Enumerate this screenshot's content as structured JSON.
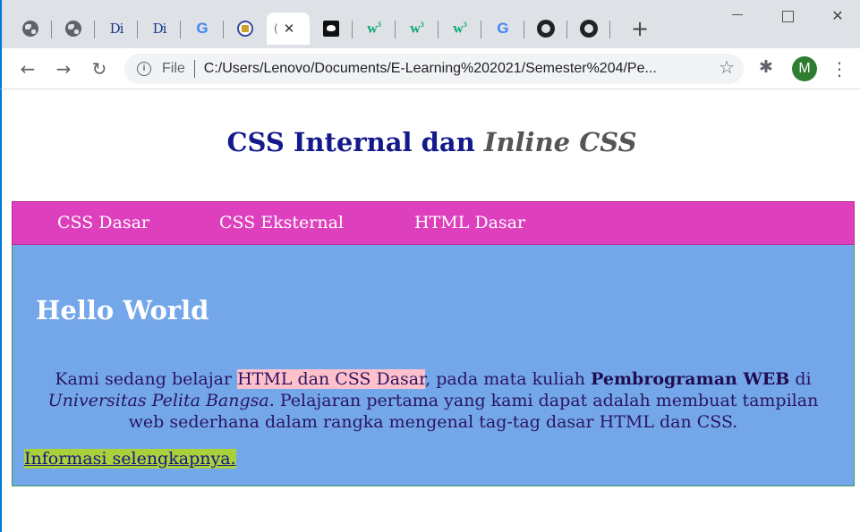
{
  "browser": {
    "tabs": [
      {
        "icon": "globe-icon"
      },
      {
        "icon": "globe-icon"
      },
      {
        "icon": "di-favicon",
        "text": "Di"
      },
      {
        "icon": "di-favicon",
        "text": "Di"
      },
      {
        "icon": "google-icon",
        "text": "G"
      },
      {
        "icon": "university-icon"
      },
      {
        "icon": "page-icon",
        "active": true,
        "label": "(",
        "close": "✕"
      },
      {
        "icon": "black-logo-icon"
      },
      {
        "icon": "w3schools-icon",
        "text": "w",
        "sup": "3"
      },
      {
        "icon": "w3schools-icon",
        "text": "w",
        "sup": "3"
      },
      {
        "icon": "w3schools-icon",
        "text": "w",
        "sup": "3"
      },
      {
        "icon": "google-icon",
        "text": "G"
      },
      {
        "icon": "github-icon"
      },
      {
        "icon": "github-icon"
      }
    ],
    "new_tab": "+",
    "window_close": "✕",
    "nav": {
      "back": "←",
      "forward": "→",
      "reload": "↻"
    },
    "address": {
      "info": "i",
      "scheme_label": "File",
      "url": "C:/Users/Lenovo/Documents/E-Learning%202021/Semester%204/Pe..."
    },
    "star": "☆",
    "extensions": "✱",
    "profile_initial": "M",
    "menu": "⋮"
  },
  "page": {
    "title_plain": "CSS Internal dan ",
    "title_italic": "Inline CSS",
    "nav_links": [
      "CSS Dasar",
      "CSS Eksternal",
      "HTML Dasar"
    ],
    "heading": "Hello World",
    "paragraph": {
      "part1": "Kami sedang belajar ",
      "highlight": "HTML dan CSS Dasar",
      "part2": ", pada mata kuliah ",
      "bold": "Pembrograman WEB",
      "part3": " di ",
      "italic": "Universitas Pelita Bangsa",
      "part4": ". Pelajaran pertama yang kami dapat adalah membuat tampilan web sederhana dalam rangka mengenal tag-tag dasar HTML dan CSS."
    },
    "more_link": "Informasi selengkapnya."
  },
  "colors": {
    "title": "#141a8c",
    "title_italic": "#555555",
    "navbar_bg": "#dd3fbd",
    "content_bg": "#74a7ea",
    "highlight_bg": "#ffc0cb",
    "link_bg": "#a9d23a"
  }
}
